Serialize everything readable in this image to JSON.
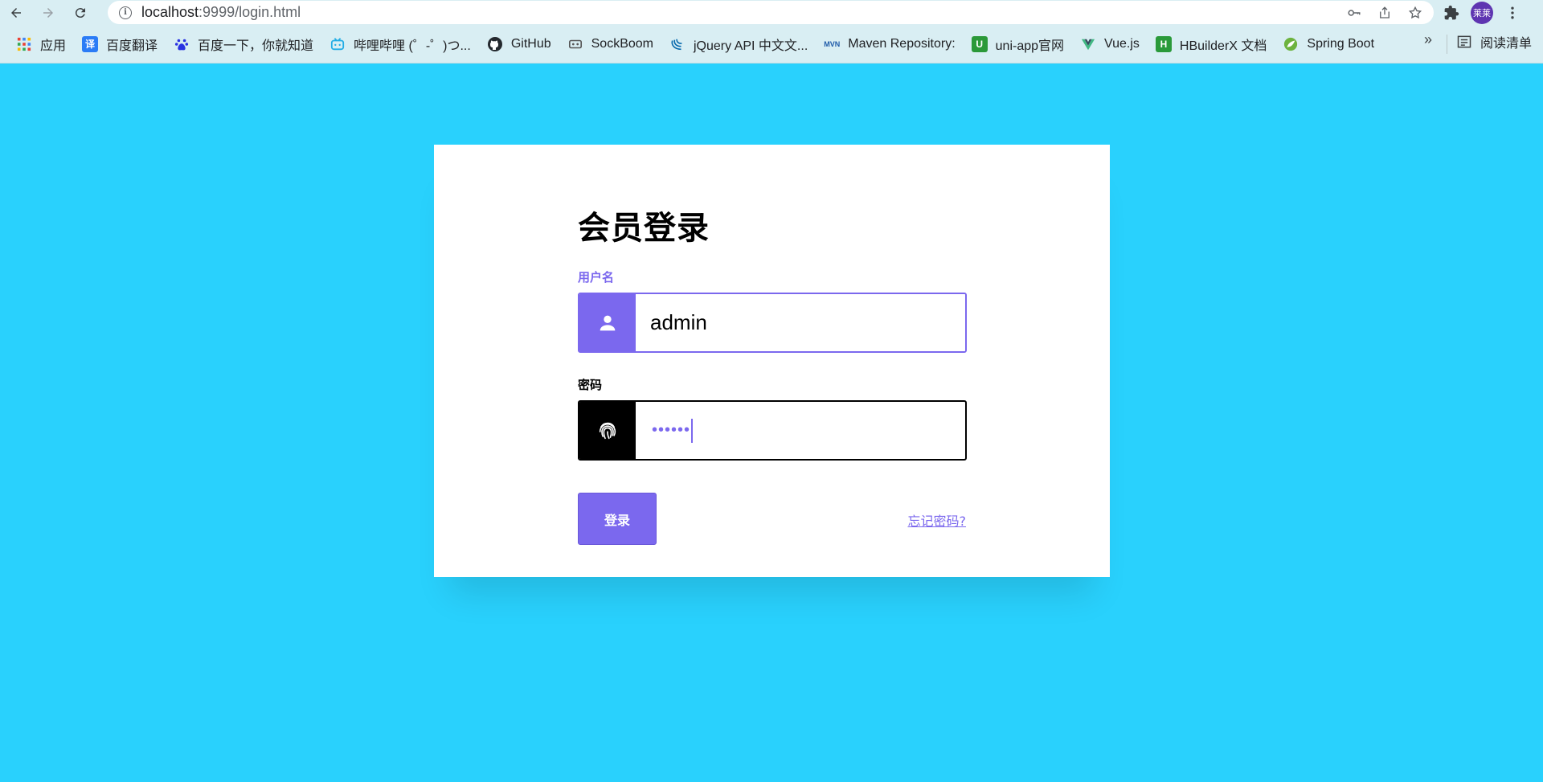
{
  "browser": {
    "url_host": "localhost",
    "url_path": ":9999/login.html",
    "avatar_text": "莱莱",
    "bookmarks": [
      {
        "label": "应用",
        "icon": "apps-grid-icon",
        "color": "#ea4335"
      },
      {
        "label": "百度翻译",
        "icon": "baidu-translate-icon",
        "color": "#2b7cf6"
      },
      {
        "label": "百度一下，你就知道",
        "icon": "baidu-paw-icon",
        "color": "#2932e1"
      },
      {
        "label": "哔哩哔哩 (゜-゜)つ...",
        "icon": "bilibili-icon",
        "color": "#23ade5"
      },
      {
        "label": "GitHub",
        "icon": "github-icon",
        "color": "#24292e"
      },
      {
        "label": "SockBoom",
        "icon": "sockboom-icon",
        "color": "#555555"
      },
      {
        "label": "jQuery API 中文文...",
        "icon": "jquery-icon",
        "color": "#0769ad"
      },
      {
        "label": "Maven Repository:",
        "icon": "maven-icon",
        "color": "#1e5aa8"
      },
      {
        "label": "uni-app官网",
        "icon": "uniapp-icon",
        "color": "#2b9939"
      },
      {
        "label": "Vue.js",
        "icon": "vue-icon",
        "color": "#41b883"
      },
      {
        "label": "HBuilderX 文档",
        "icon": "hbuilderx-icon",
        "color": "#2a9a3a"
      },
      {
        "label": "Spring Boot",
        "icon": "spring-icon",
        "color": "#6db33f"
      }
    ],
    "overflow": "»",
    "reading_list": "阅读清单"
  },
  "login": {
    "title": "会员登录",
    "username_label": "用户名",
    "username_value": "admin",
    "password_label": "密码",
    "password_masked": "••••••",
    "submit_label": "登录",
    "forgot_label": "忘记密码?"
  },
  "colors": {
    "page_bg": "#29d1fd",
    "accent": "#7b68ee",
    "card_bg": "#ffffff"
  }
}
